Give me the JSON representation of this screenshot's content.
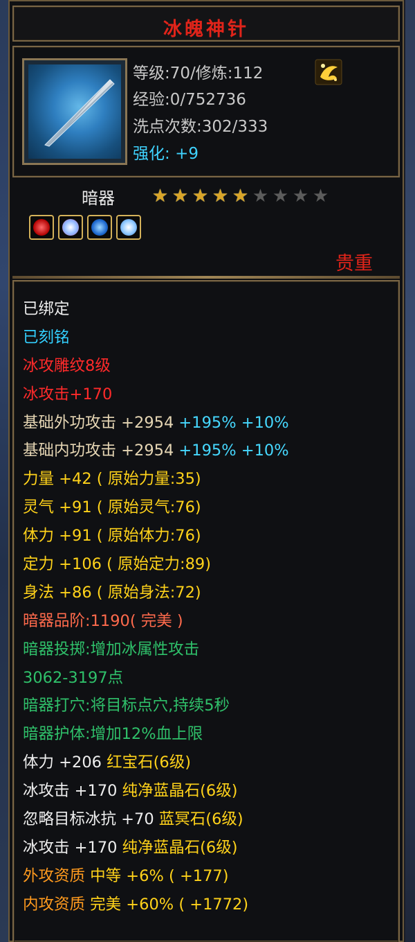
{
  "item": {
    "name": "冰魄神针",
    "level_line": "等级:70/修炼:112",
    "exp_line": "经验:0/752736",
    "wash_line": "洗点次数:302/333",
    "enhance_label": "强化:",
    "enhance_value": "+9",
    "type": "暗器",
    "stars": {
      "filled": 5,
      "total": 9
    },
    "quality": "贵重",
    "socket_gems": [
      "red-gem-icon",
      "ice-crystal-gem-icon",
      "blue-gem-icon",
      "ice-crystal-gem-icon"
    ]
  },
  "colors": {
    "title": "#e0241a",
    "bound": "#eeeeee",
    "engraved": "#33d0ff",
    "rune": "#ff2a2a",
    "base_attack": "#e6d6b4",
    "percent": "#46d8ff",
    "stat": "#ffd21a",
    "grade": "#ff6a4c",
    "skill": "#2fc06a",
    "aptitude": "#ff9a1e"
  },
  "attributes": [
    {
      "id": "bound",
      "color": "c-white",
      "parts": [
        {
          "text": "已绑定"
        }
      ]
    },
    {
      "id": "engraved",
      "color": "c-cyan",
      "parts": [
        {
          "text": "已刻铭"
        }
      ]
    },
    {
      "id": "rune",
      "color": "c-red",
      "parts": [
        {
          "text": "冰攻雕纹8级"
        }
      ]
    },
    {
      "id": "ice-attack-bonus",
      "color": "c-red",
      "parts": [
        {
          "text": "冰攻击+170"
        }
      ]
    },
    {
      "id": "base-outer-attack",
      "color": "c-beige",
      "parts": [
        {
          "text": "基础外功攻击 +2954 "
        },
        {
          "text": "+195% +10%",
          "color": "c-cyanb"
        }
      ]
    },
    {
      "id": "base-inner-attack",
      "color": "c-beige",
      "parts": [
        {
          "text": "基础内功攻击 +2954 "
        },
        {
          "text": "+195% +10%",
          "color": "c-cyanb"
        }
      ]
    },
    {
      "id": "strength",
      "color": "c-yellow",
      "parts": [
        {
          "text": "力量 +42 ( 原始力量:35)"
        }
      ]
    },
    {
      "id": "spirit",
      "color": "c-yellow",
      "parts": [
        {
          "text": "灵气 +91 ( 原始灵气:76)"
        }
      ]
    },
    {
      "id": "constitution",
      "color": "c-yellow",
      "parts": [
        {
          "text": "体力 +91 ( 原始体力:76)"
        }
      ]
    },
    {
      "id": "focus",
      "color": "c-yellow",
      "parts": [
        {
          "text": "定力 +106 ( 原始定力:89)"
        }
      ]
    },
    {
      "id": "agility",
      "color": "c-yellow",
      "parts": [
        {
          "text": "身法 +86 ( 原始身法:72)"
        }
      ]
    },
    {
      "id": "grade",
      "color": "c-salmon",
      "parts": [
        {
          "text": "暗器品阶:1190( 完美 )"
        }
      ]
    },
    {
      "id": "skill-throw",
      "color": "c-green",
      "parts": [
        {
          "text": "暗器投掷:增加冰属性攻击"
        }
      ]
    },
    {
      "id": "skill-throw-range",
      "color": "c-green",
      "parts": [
        {
          "text": "3062-3197点"
        }
      ]
    },
    {
      "id": "skill-acupoint",
      "color": "c-green",
      "parts": [
        {
          "text": "暗器打穴:将目标点穴,持续5秒"
        }
      ]
    },
    {
      "id": "skill-guard",
      "color": "c-green",
      "parts": [
        {
          "text": "暗器护体:增加12%血上限"
        }
      ]
    },
    {
      "id": "gem-1",
      "color": "c-white",
      "parts": [
        {
          "text": "体力 +206 "
        },
        {
          "text": "红宝石(6级)",
          "color": "c-yellow"
        }
      ]
    },
    {
      "id": "gem-2",
      "color": "c-white",
      "parts": [
        {
          "text": "冰攻击 +170 "
        },
        {
          "text": "纯净蓝晶石(6级)",
          "color": "c-yellow"
        }
      ]
    },
    {
      "id": "gem-3",
      "color": "c-white",
      "parts": [
        {
          "text": "忽略目标冰抗 +70 "
        },
        {
          "text": "蓝冥石(6级)",
          "color": "c-yellow"
        }
      ]
    },
    {
      "id": "gem-4",
      "color": "c-white",
      "parts": [
        {
          "text": "冰攻击 +170 "
        },
        {
          "text": "纯净蓝晶石(6级)",
          "color": "c-yellow"
        }
      ]
    },
    {
      "id": "outer-aptitude",
      "color": "c-orange",
      "parts": [
        {
          "text": "外攻资质  "
        },
        {
          "text": "中等 +6% ( +177)",
          "color": "c-yellow"
        }
      ]
    },
    {
      "id": "inner-aptitude",
      "color": "c-orange",
      "parts": [
        {
          "text": "内攻资质  "
        },
        {
          "text": "完美 +60% ( +1772)",
          "color": "c-yellow"
        }
      ]
    }
  ]
}
